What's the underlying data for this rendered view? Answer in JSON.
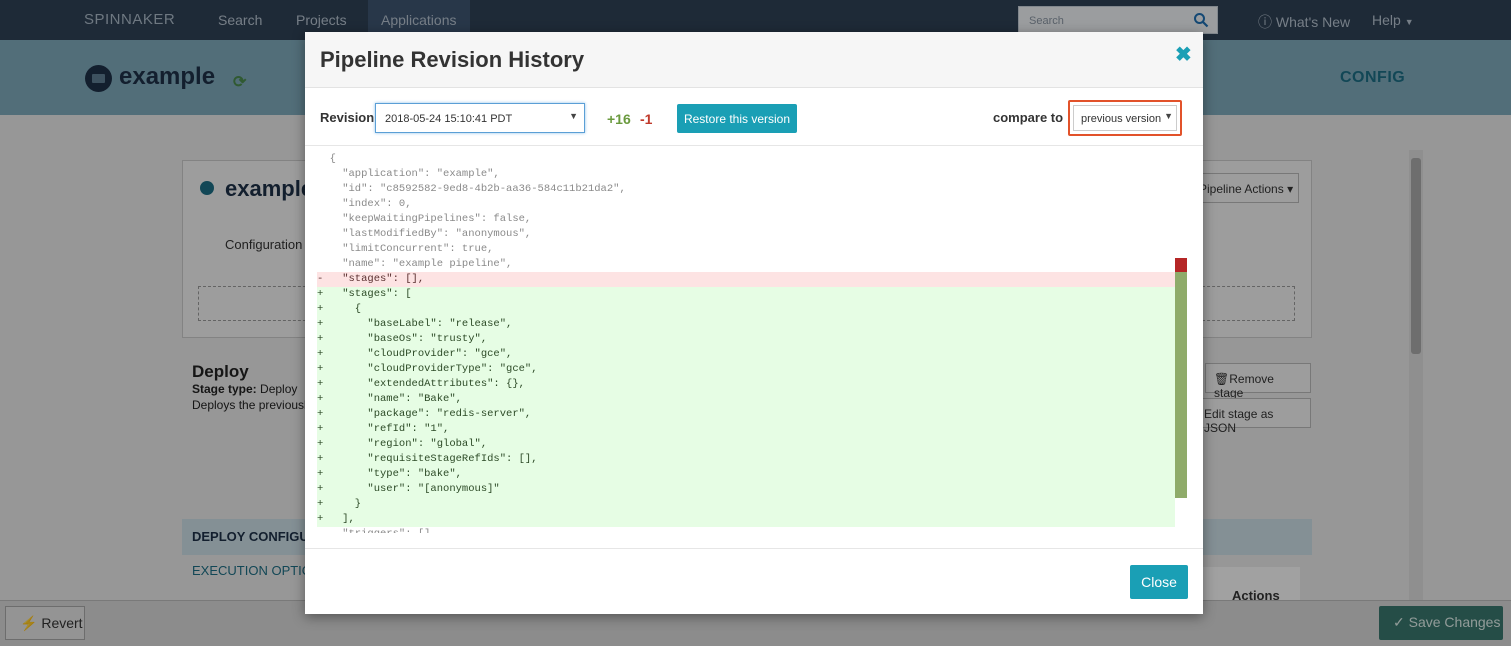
{
  "nav": {
    "brand": "SPINNAKER",
    "links": [
      "Search",
      "Projects",
      "Applications"
    ],
    "search_placeholder": "Search",
    "whats_new": "What's New",
    "help": "Help"
  },
  "app": {
    "name": "example",
    "config": "CONFIG"
  },
  "background": {
    "pipeline_title": "example",
    "configuration": "Configuration",
    "pipeline_actions": "Pipeline Actions",
    "deploy_title": "Deploy",
    "stage_type_label": "Stage type:",
    "stage_type_value": "Deploy",
    "deploy_desc": "Deploys the previously",
    "remove_stage": "Remove stage",
    "edit_json": "Edit stage as JSON",
    "deploy_config": "DEPLOY CONFIGUR",
    "execution_options": "EXECUTION OPTION",
    "actions": "Actions",
    "revert": "Revert",
    "save_changes": "Save Changes"
  },
  "modal": {
    "title": "Pipeline Revision History",
    "revision_label": "Revision",
    "revision_value": "2018-05-24 15:10:41 PDT",
    "additions": "+16",
    "deletions": "-1",
    "restore_button": "Restore this version",
    "compare_label": "compare to",
    "compare_value": "previous version",
    "close_button": "Close",
    "diff_lines": [
      {
        "type": "ctx",
        "text": "  {"
      },
      {
        "type": "ctx",
        "text": "    \"application\": \"example\","
      },
      {
        "type": "ctx",
        "text": "    \"id\": \"c8592582-9ed8-4b2b-aa36-584c11b21da2\","
      },
      {
        "type": "ctx",
        "text": "    \"index\": 0,"
      },
      {
        "type": "ctx",
        "text": "    \"keepWaitingPipelines\": false,"
      },
      {
        "type": "ctx",
        "text": "    \"lastModifiedBy\": \"anonymous\","
      },
      {
        "type": "ctx",
        "text": "    \"limitConcurrent\": true,"
      },
      {
        "type": "ctx",
        "text": "    \"name\": \"example pipeline\","
      },
      {
        "type": "del",
        "text": "-   \"stages\": [],"
      },
      {
        "type": "add",
        "text": "+   \"stages\": ["
      },
      {
        "type": "add",
        "text": "+     {"
      },
      {
        "type": "add",
        "text": "+       \"baseLabel\": \"release\","
      },
      {
        "type": "add",
        "text": "+       \"baseOs\": \"trusty\","
      },
      {
        "type": "add",
        "text": "+       \"cloudProvider\": \"gce\","
      },
      {
        "type": "add",
        "text": "+       \"cloudProviderType\": \"gce\","
      },
      {
        "type": "add",
        "text": "+       \"extendedAttributes\": {},"
      },
      {
        "type": "add",
        "text": "+       \"name\": \"Bake\","
      },
      {
        "type": "add",
        "text": "+       \"package\": \"redis-server\","
      },
      {
        "type": "add",
        "text": "+       \"refId\": \"1\","
      },
      {
        "type": "add",
        "text": "+       \"region\": \"global\","
      },
      {
        "type": "add",
        "text": "+       \"requisiteStageRefIds\": [],"
      },
      {
        "type": "add",
        "text": "+       \"type\": \"bake\","
      },
      {
        "type": "add",
        "text": "+       \"user\": \"[anonymous]\""
      },
      {
        "type": "add",
        "text": "+     }"
      },
      {
        "type": "add",
        "text": "+   ],"
      },
      {
        "type": "ctx",
        "text": "    \"triggers\": []"
      }
    ]
  },
  "colors": {
    "nav_bg": "#2f4155",
    "accent": "#1a9fb5",
    "highlight_border": "#e2522a",
    "add_bg": "#e6fde4",
    "del_bg": "#fde3e3"
  }
}
